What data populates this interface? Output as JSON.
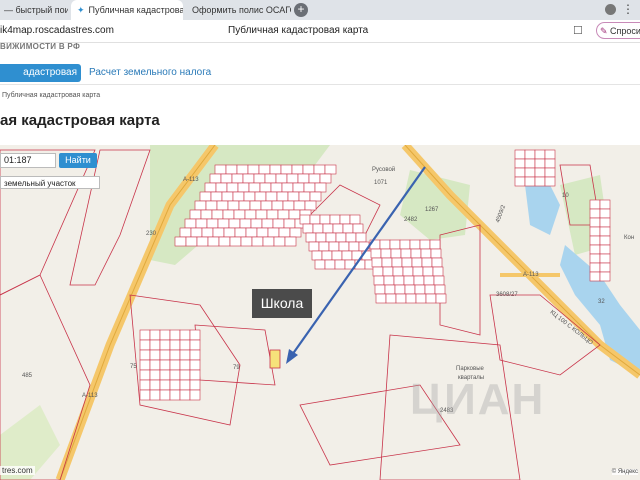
{
  "browser": {
    "tabs": [
      {
        "label": "— быстрый поиск",
        "close": "×"
      },
      {
        "label": "Публичная кадастровая",
        "close": "×"
      },
      {
        "label": "Оформить полис ОСАГО"
      }
    ],
    "new_tab": "+",
    "url": "ik4map.roscadastres.com",
    "page_title": "Публичная кадастровая карта",
    "ask_button": "Спросить"
  },
  "site": {
    "brand": "ВИЖИМОСТИ В РФ",
    "nav": [
      "адастровая карта",
      "Расчет земельного налога"
    ],
    "breadcrumb": "Публичная кадастровая карта",
    "heading": "ая кадастровая карта"
  },
  "map": {
    "search_value": "01:187",
    "find_button": "Найти",
    "type_select": "земельный участок",
    "annotation": "Школа",
    "labels": {
      "road_a113_top": "А-113",
      "road_a113_bottom": "А-113",
      "n230": "230",
      "n485": "485",
      "n75": "75",
      "n79": "79",
      "n1071": "1071",
      "n1267": "1267",
      "n2482": "2482",
      "n3608": "3608/27",
      "n4509": "4509/2",
      "n2483": "2483",
      "n10": "10",
      "n32": "32",
      "parkovye": "Парковые",
      "kvartaly": "кварталы",
      "rusovoy": "Русовой",
      "kon": "Кон",
      "road_a113_right": "А-113",
      "road_name": "КЦ 100 С КОЛЬЦО"
    },
    "watermark": "ЦИАН",
    "footer": "tres.com",
    "copyright": "© Яндекс"
  },
  "colors": {
    "accent": "#2f8fd0",
    "parcel": "#c8344a",
    "arrow": "#3a63b0",
    "park": "#cfe3b8",
    "water": "#a9d4ee"
  }
}
